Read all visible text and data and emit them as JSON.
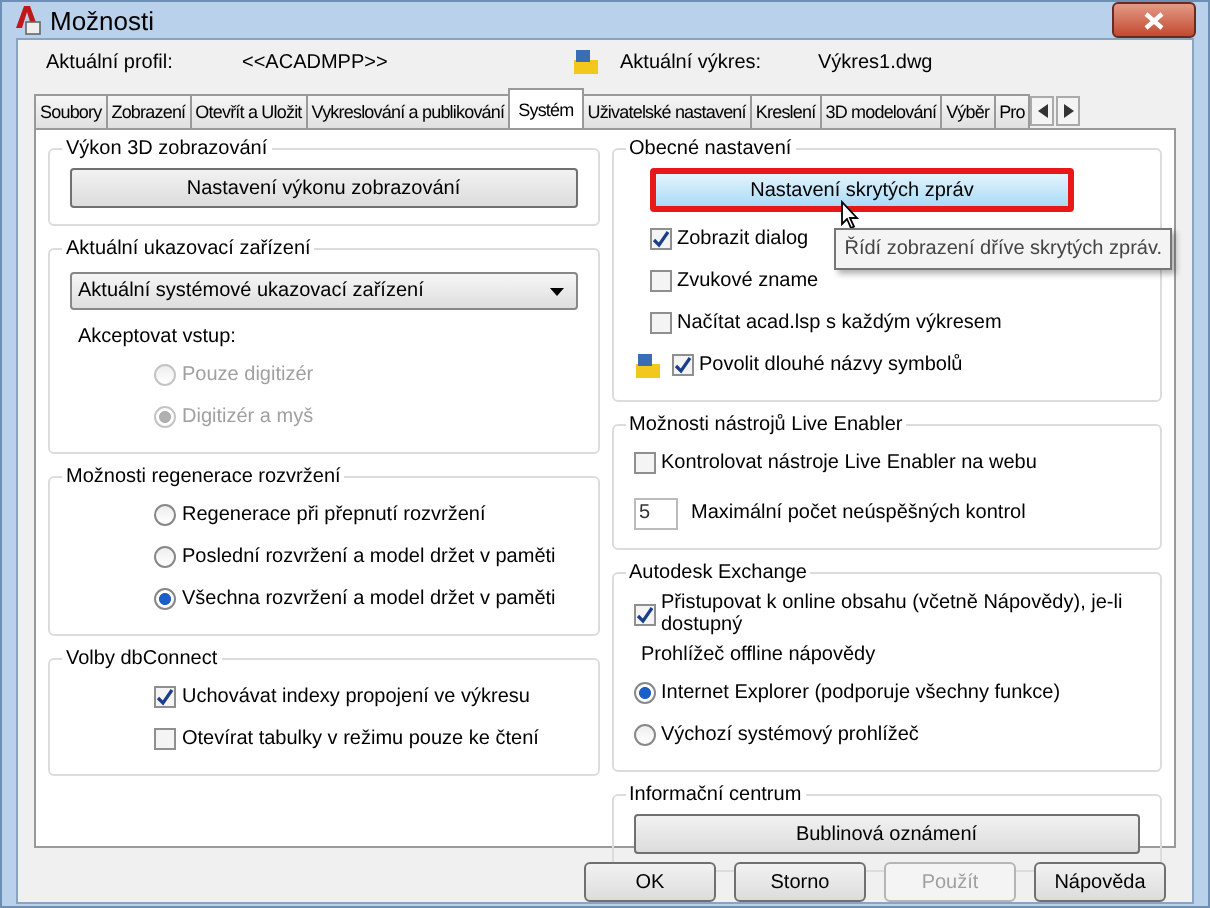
{
  "window": {
    "title": "Možnosti"
  },
  "profile": {
    "label": "Aktuální profil:",
    "value": "<<ACADMPP>>"
  },
  "drawing": {
    "label": "Aktuální výkres:",
    "value": "Výkres1.dwg"
  },
  "tabs": [
    {
      "label": "Soubory",
      "selected": false
    },
    {
      "label": "Zobrazení",
      "selected": false
    },
    {
      "label": "Otevřít a Uložit",
      "selected": false
    },
    {
      "label": "Vykreslování a publikování",
      "selected": false
    },
    {
      "label": "Systém",
      "selected": true
    },
    {
      "label": "Uživatelské nastavení",
      "selected": false
    },
    {
      "label": "Kreslení",
      "selected": false
    },
    {
      "label": "3D modelování",
      "selected": false
    },
    {
      "label": "Výběr",
      "selected": false
    },
    {
      "label": "Pro",
      "selected": false
    }
  ],
  "left_groups": [
    {
      "title": "Výkon 3D zobrazování",
      "items": [
        {
          "kind": "button",
          "label": "Nastavení výkonu zobrazování",
          "highlighted": false
        }
      ]
    },
    {
      "title": "Aktuální ukazovací zařízení",
      "items": [
        {
          "kind": "dropdown",
          "value": "Aktuální systémové ukazovací zařízení"
        },
        {
          "kind": "label",
          "text": "Akceptovat vstup:"
        },
        {
          "kind": "radio",
          "label": "Pouze digitizér",
          "selected": false,
          "disabled": true
        },
        {
          "kind": "radio",
          "label": "Digitizér a myš",
          "selected": true,
          "disabled": true
        }
      ]
    },
    {
      "title": "Možnosti regenerace rozvržení",
      "items": [
        {
          "kind": "radio",
          "label": "Regenerace při přepnutí rozvržení",
          "selected": false,
          "disabled": false
        },
        {
          "kind": "radio",
          "label": "Poslední rozvržení a model držet v paměti",
          "selected": false,
          "disabled": false
        },
        {
          "kind": "radio",
          "label": "Všechna rozvržení a model držet v paměti",
          "selected": true,
          "disabled": false
        }
      ]
    },
    {
      "title": "Volby dbConnect",
      "items": [
        {
          "kind": "checkbox",
          "label": "Uchovávat indexy propojení ve výkresu",
          "checked": true,
          "icon": false
        },
        {
          "kind": "checkbox",
          "label": "Otevírat tabulky v režimu pouze ke čtení",
          "checked": false,
          "icon": false
        }
      ]
    }
  ],
  "right_groups": [
    {
      "title": "Obecné nastavení",
      "items": [
        {
          "kind": "button",
          "label": "Nastavení skrytých zpráv",
          "highlighted": true
        },
        {
          "kind": "checkbox",
          "label": "Zobrazit dialog",
          "checked": true,
          "icon": false
        },
        {
          "kind": "checkbox",
          "label": "Zvukové zname",
          "checked": false,
          "icon": false
        },
        {
          "kind": "checkbox",
          "label": "Načítat acad.lsp s každým výkresem",
          "checked": false,
          "icon": false
        },
        {
          "kind": "checkbox",
          "label": "Povolit dlouhé názvy symbolů",
          "checked": true,
          "icon": true
        }
      ]
    },
    {
      "title": "Možnosti nástrojů Live Enabler",
      "items": [
        {
          "kind": "checkbox",
          "label": "Kontrolovat nástroje Live Enabler na webu",
          "checked": false,
          "icon": false
        },
        {
          "kind": "number",
          "value": "5",
          "label": "Maximální počet neúspěšných kontrol"
        }
      ]
    },
    {
      "title": "Autodesk Exchange",
      "items": [
        {
          "kind": "checkbox",
          "label": "Přistupovat k online obsahu (včetně Nápovědy), je-li dostupný",
          "checked": true,
          "icon": false
        },
        {
          "kind": "label",
          "text": "Prohlížeč offline nápovědy"
        },
        {
          "kind": "radio",
          "label": "Internet Explorer (podporuje všechny funkce)",
          "selected": true,
          "disabled": false
        },
        {
          "kind": "radio",
          "label": "Výchozí systémový prohlížeč",
          "selected": false,
          "disabled": false
        }
      ]
    },
    {
      "title": "Informační centrum",
      "items": [
        {
          "kind": "button",
          "label": "Bublinová oznámení",
          "highlighted": false
        }
      ]
    }
  ],
  "tooltip": {
    "text": "Řídí zobrazení dříve skrytých zpráv."
  },
  "buttons": [
    {
      "label": "OK",
      "disabled": false
    },
    {
      "label": "Storno",
      "disabled": false
    },
    {
      "label": "Použít",
      "disabled": true
    },
    {
      "label": "Nápověda",
      "disabled": false
    }
  ]
}
